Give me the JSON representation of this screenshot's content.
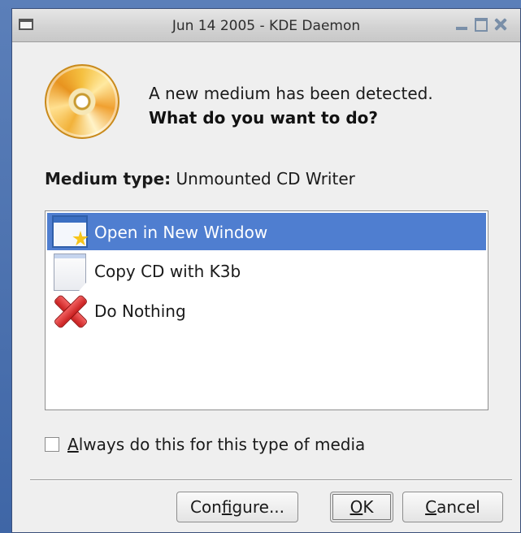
{
  "window": {
    "title": "Jun 14 2005 - KDE Daemon"
  },
  "message": {
    "line1": "A new medium has been detected.",
    "line2": "What do you want to do?"
  },
  "medium": {
    "label": "Medium type:",
    "value": "Unmounted CD Writer"
  },
  "actions": [
    {
      "label": "Open in New Window",
      "icon": "window-star-icon",
      "selected": true
    },
    {
      "label": "Copy CD with K3b",
      "icon": "document-icon",
      "selected": false
    },
    {
      "label": "Do Nothing",
      "icon": "red-x-icon",
      "selected": false
    }
  ],
  "always": {
    "mnemonic": "A",
    "rest": "lways do this for this type of media",
    "checked": false
  },
  "buttons": {
    "configure_pre": "Con",
    "configure_mnemonic": "f",
    "configure_post": "igure...",
    "ok_mnemonic": "O",
    "ok_post": "K",
    "cancel_mnemonic": "C",
    "cancel_post": "ancel"
  },
  "colors": {
    "selection": "#4f7ed0",
    "dialog_bg": "#efefef"
  }
}
